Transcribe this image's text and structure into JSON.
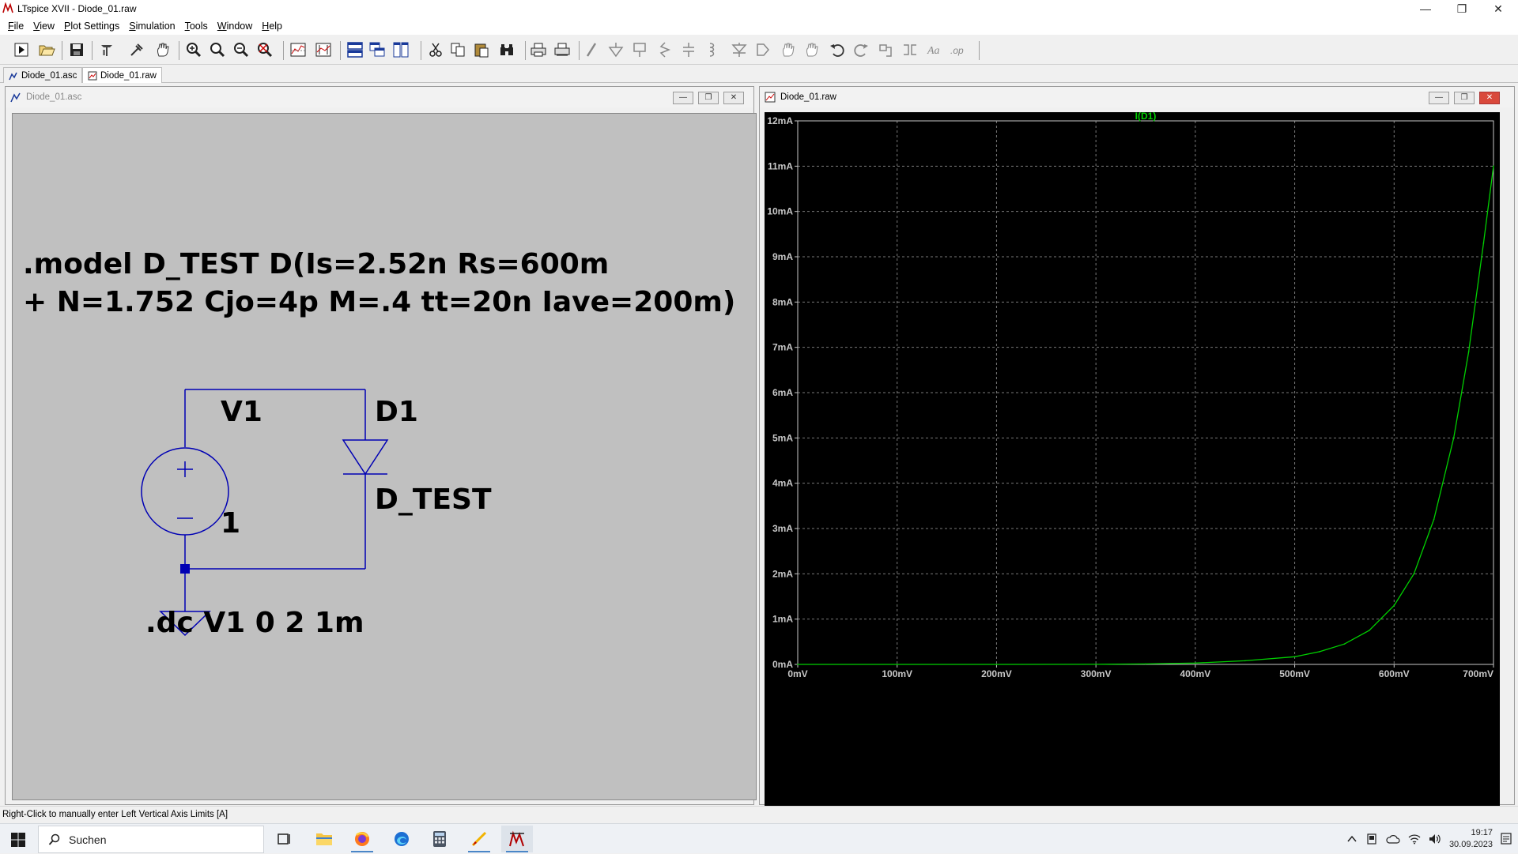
{
  "app": {
    "title": "LTspice XVII - Diode_01.raw",
    "window_controls": {
      "minimize": "—",
      "restore": "❐",
      "close": "✕"
    }
  },
  "menu": [
    "File",
    "View",
    "Plot Settings",
    "Simulation",
    "Tools",
    "Window",
    "Help"
  ],
  "toolbar": {
    "icons": [
      "run-icon",
      "open-icon",
      "save-icon",
      "control-panel-icon",
      "run-pick-icon",
      "pan-icon",
      "zoom-in-icon",
      "zoom-back-icon",
      "zoom-out-icon",
      "zoom-fit-icon",
      "autorange-icon",
      "autorange-y-icon",
      "tile-horizontal-icon",
      "cascade-icon",
      "tile-vertical-icon",
      "cut-icon",
      "copy-icon",
      "paste-icon",
      "find-icon",
      "print-icon",
      "print-setup-icon",
      "wire-icon",
      "ground-icon",
      "label-icon",
      "resistor-icon",
      "capacitor-icon",
      "inductor-icon",
      "diode-icon",
      "component-icon",
      "move-icon",
      "drag-icon",
      "undo-icon",
      "redo-icon",
      "rotate-icon",
      "mirror-icon",
      "text-icon",
      "spice-directive-icon"
    ]
  },
  "doc_tabs": [
    {
      "label": "Diode_01.asc",
      "active": false
    },
    {
      "label": "Diode_01.raw",
      "active": true
    }
  ],
  "schematic_window": {
    "title": "Diode_01.asc",
    "model_line1": ".model D_TEST D(Is=2.52n Rs=600m",
    "model_line2": "+ N=1.752 Cjo=4p M=.4 tt=20n Iave=200m)",
    "source_name": "V1",
    "source_value": "1",
    "diode_name": "D1",
    "diode_model": "D_TEST",
    "dc_directive": ".dc V1 0 2 1m",
    "wire_color": "#0000b4"
  },
  "plot_window": {
    "title": "Diode_01.raw",
    "trace_label": "I(D1)",
    "trace_color": "#00d000",
    "axis_color": "#c8c8c8"
  },
  "chart_data": {
    "type": "line",
    "title": "",
    "xlabel": "",
    "ylabel": "",
    "x_ticks": [
      "0mV",
      "100mV",
      "200mV",
      "300mV",
      "400mV",
      "500mV",
      "600mV",
      "700mV"
    ],
    "y_ticks": [
      "0mA",
      "1mA",
      "2mA",
      "3mA",
      "4mA",
      "5mA",
      "6mA",
      "7mA",
      "8mA",
      "9mA",
      "10mA",
      "11mA",
      "12mA"
    ],
    "xlim": [
      0,
      700
    ],
    "ylim": [
      0,
      12
    ],
    "x_unit": "mV",
    "y_unit": "mA",
    "grid": true,
    "series": [
      {
        "name": "I(D1)",
        "x": [
          0,
          100,
          200,
          300,
          350,
          400,
          450,
          500,
          525,
          550,
          575,
          600,
          620,
          640,
          660,
          675,
          690,
          700
        ],
        "y": [
          0,
          0,
          0,
          0.002,
          0.01,
          0.03,
          0.08,
          0.17,
          0.28,
          0.45,
          0.75,
          1.3,
          2.0,
          3.2,
          5.0,
          6.9,
          9.3,
          11.0
        ]
      }
    ]
  },
  "status": {
    "text": "Right-Click to manually enter Left Vertical Axis Limits [A]"
  },
  "taskbar": {
    "search_placeholder": "Suchen",
    "apps": [
      "task-view-icon",
      "file-explorer-icon",
      "firefox-icon",
      "browser-icon",
      "calculator-icon",
      "app-icon",
      "ltspice-icon"
    ],
    "time": "19:17",
    "date": "30.09.2023"
  }
}
